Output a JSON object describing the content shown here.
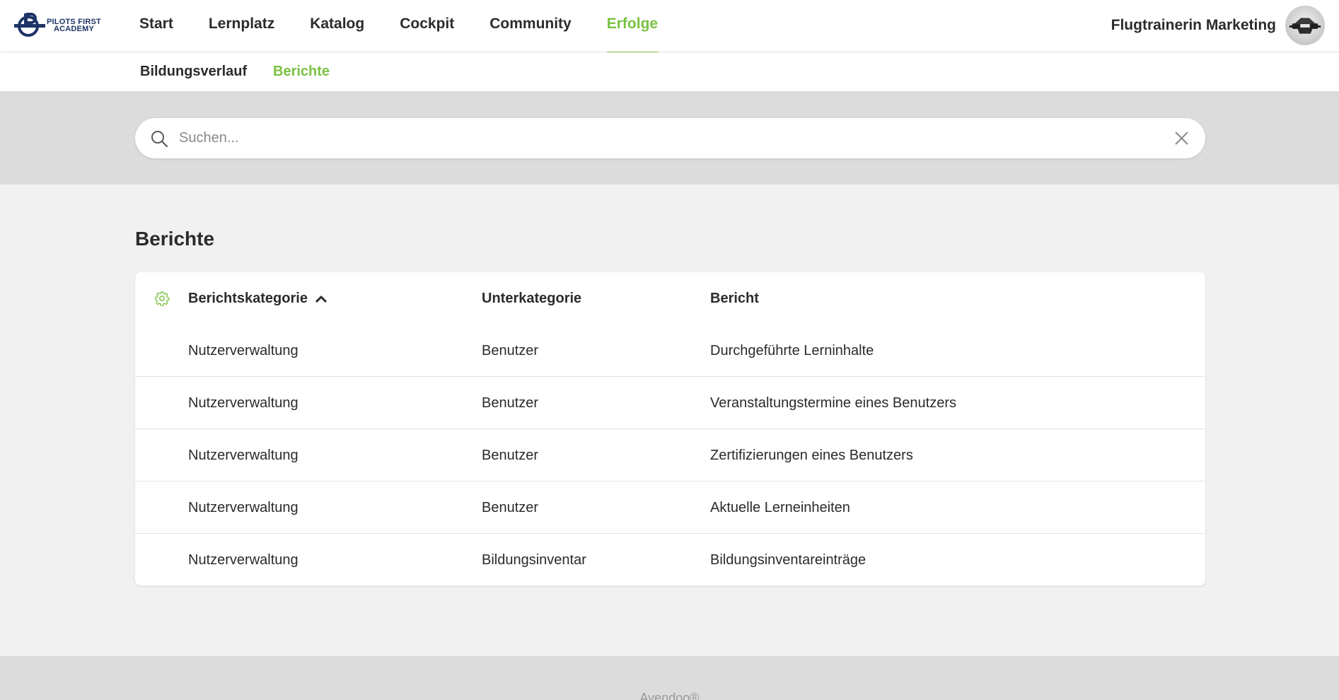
{
  "brand": {
    "logo_line1": "PILOTS FIRST",
    "logo_line2": "ACADEMY",
    "accent_color": "#7ac142",
    "logo_color": "#1d3466"
  },
  "nav": {
    "items": [
      {
        "label": "Start",
        "active": false
      },
      {
        "label": "Lernplatz",
        "active": false
      },
      {
        "label": "Katalog",
        "active": false
      },
      {
        "label": "Cockpit",
        "active": false
      },
      {
        "label": "Community",
        "active": false
      },
      {
        "label": "Erfolge",
        "active": true
      }
    ]
  },
  "user": {
    "name": "Flugtrainerin Marketing",
    "avatar_icon": "airplane-avatar"
  },
  "subnav": {
    "items": [
      {
        "label": "Bildungsverlauf",
        "active": false
      },
      {
        "label": "Berichte",
        "active": true
      }
    ]
  },
  "search": {
    "placeholder": "Suchen...",
    "value": ""
  },
  "page": {
    "title": "Berichte"
  },
  "table": {
    "columns": [
      {
        "label": "Berichtskategorie",
        "sort": "ascending"
      },
      {
        "label": "Unterkategorie"
      },
      {
        "label": "Bericht"
      }
    ],
    "rows": [
      {
        "category": "Nutzerverwaltung",
        "subcategory": "Benutzer",
        "report": "Durchgeführte Lerninhalte"
      },
      {
        "category": "Nutzerverwaltung",
        "subcategory": "Benutzer",
        "report": "Veranstaltungstermine eines Benutzers"
      },
      {
        "category": "Nutzerverwaltung",
        "subcategory": "Benutzer",
        "report": "Zertifizierungen eines Benutzers"
      },
      {
        "category": "Nutzerverwaltung",
        "subcategory": "Benutzer",
        "report": "Aktuelle Lerneinheiten"
      },
      {
        "category": "Nutzerverwaltung",
        "subcategory": "Bildungsinventar",
        "report": "Bildungsinventareinträge"
      }
    ]
  },
  "footer": {
    "text": "Avendoo®"
  }
}
